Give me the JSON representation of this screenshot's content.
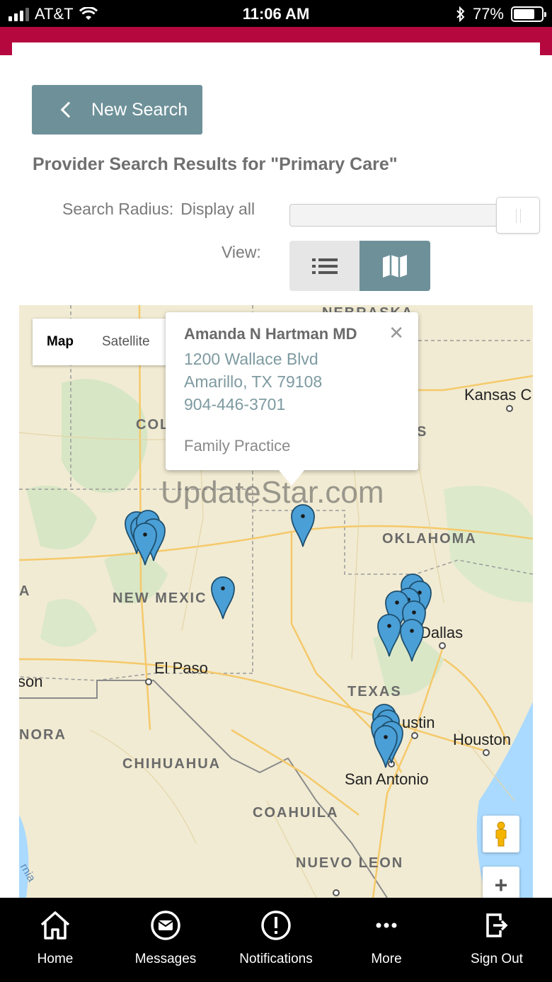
{
  "status_bar": {
    "carrier": "AT&T",
    "time": "11:06 AM",
    "battery": "77%",
    "battery_level": 0.77
  },
  "toolbar": {
    "new_search_label": "New Search"
  },
  "results": {
    "title": "Provider Search Results for \"Primary Care\""
  },
  "search_radius": {
    "label": "Search Radius:",
    "value": "Display all"
  },
  "view_toggle": {
    "label": "View:",
    "options": [
      "list",
      "map"
    ],
    "selected": "map"
  },
  "map": {
    "type_options": {
      "map": "Map",
      "satellite": "Satellite"
    },
    "selected_type": "Map",
    "watermark": "UpdateStar.com",
    "labels": {
      "nebraska": "NEBRASKA",
      "colorado": "COL",
      "kansas_city": "Kansas C",
      "kansas_s": "S",
      "oklahoma": "OKLAHOMA",
      "new_mexico": "NEW MEXIC",
      "dallas": "Dallas",
      "el_paso": "El Paso",
      "son": "son",
      "texas": "TEXAS",
      "austin": "ustin",
      "houston": "Houston",
      "nora": "NORA",
      "chihuahua": "CHIHUAHUA",
      "san_antonio": "San Antonio",
      "coahuila": "COAHUILA",
      "nuevo_leon": "NUEVO LEON",
      "a_label": "A",
      "rnia": "rnia"
    },
    "pin_color": "#4a9fd6",
    "infowindow": {
      "name": "Amanda N Hartman MD",
      "address_line1": "1200 Wallace Blvd",
      "address_line2": "Amarillo, TX 79108",
      "phone": "904-446-3701",
      "specialty": "Family Practice"
    }
  },
  "bottom_nav": {
    "items": [
      {
        "label": "Home",
        "icon": "home-icon"
      },
      {
        "label": "Messages",
        "icon": "messages-icon"
      },
      {
        "label": "Notifications",
        "icon": "notifications-icon"
      },
      {
        "label": "More",
        "icon": "more-icon"
      },
      {
        "label": "Sign Out",
        "icon": "sign-out-icon"
      }
    ]
  },
  "colors": {
    "brand": "#b5083f",
    "accent": "#6e9199",
    "nav_bg": "#000000"
  }
}
